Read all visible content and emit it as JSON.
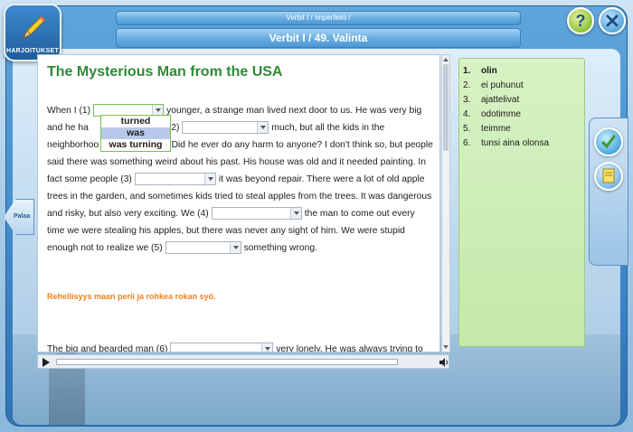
{
  "app": {
    "logo_text": "HARJOITUKSET",
    "breadcrumb": "Verbit I / Imperfekti /",
    "title": "Verbit I / 49. Valinta"
  },
  "nav": {
    "back_label": "Palaa",
    "help_label": "?"
  },
  "exercise": {
    "heading": "The Mysterious Man from the USA",
    "text": {
      "p1_a": "When I (1)",
      "p1_b": "younger, a strange man lived next door to us. He was very big and he ha",
      "p1_c": "He (2)",
      "p1_d": "much, but all the kids in the neighborhoo",
      "p1_e": "him. Did he ever do any harm to anyone? I don't think so, but people said there was something weird about his past. His house was old and it needed painting. In fact some people (3)",
      "p1_f": "it was beyond repair. There were a lot of old apple trees in the garden, and sometimes kids tried to steal apples from the trees. It was dangerous and risky, but also very exciting. We (4)",
      "p1_g": "the man to come out every time we were stealing his apples, but there was never any sight of him. We were stupid enough not to realize we (5)",
      "p1_h": "something wrong.",
      "p2_a": "The big and bearded man (6)",
      "p2_b": "very lonely. He was always trying to"
    },
    "dropdown_options": [
      "turned",
      "was",
      "was turning"
    ],
    "dropdown_selected": "was",
    "proverb": "Rehellisyys maan perii ja rohkea rokan syö."
  },
  "answers": [
    {
      "n": "1.",
      "text": "olin",
      "active": true
    },
    {
      "n": "2.",
      "text": "ei puhunut",
      "active": false
    },
    {
      "n": "3.",
      "text": "ajattelivat",
      "active": false
    },
    {
      "n": "4.",
      "text": "odotimme",
      "active": false
    },
    {
      "n": "5.",
      "text": "teimme",
      "active": false
    },
    {
      "n": "6.",
      "text": "tunsi aina olonsa",
      "active": false
    }
  ],
  "colors": {
    "heading": "#2e8b36",
    "proverb": "#f0801f",
    "frame": "#3f88c8",
    "answers_bg": "#cdecb6"
  },
  "icons": [
    "pencil-icon",
    "help-icon",
    "close-icon",
    "back-arrow-icon",
    "check-icon",
    "notes-icon",
    "play-icon",
    "volume-icon"
  ]
}
